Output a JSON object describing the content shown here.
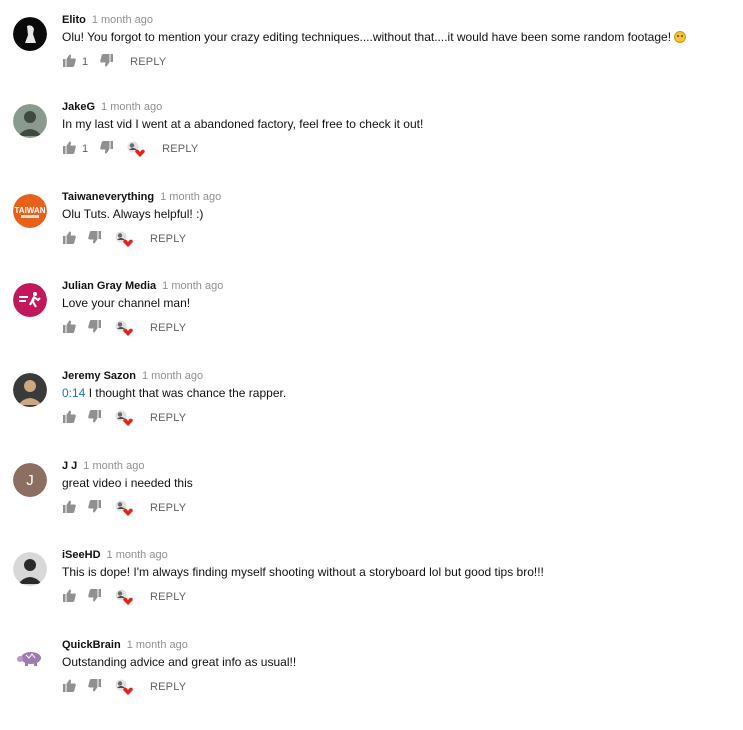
{
  "comments": [
    {
      "author": "Elito",
      "time": "1 month ago",
      "text": "Olu! You forgot to mention your crazy editing techniques....without that....it would have been some random footage!",
      "emoji": "grinning-face-emoji",
      "likes": "1",
      "reply_label": "REPLY",
      "creator_heart": false,
      "avatar": {
        "bg": "#0a0a0a",
        "fg": "#e8e8e8",
        "style": "silhouette"
      }
    },
    {
      "author": "JakeG",
      "time": "1 month ago",
      "text": "In my last vid I went at a abandoned factory, feel free to check it out!",
      "likes": "1",
      "reply_label": "REPLY",
      "creator_heart": true,
      "avatar": {
        "bg": "#8a9a8c",
        "fg": "#3e4a40",
        "style": "photo"
      }
    },
    {
      "author": "Taiwaneverything",
      "time": "1 month ago",
      "text": "Olu Tuts. Always helpful! :)",
      "likes": "",
      "reply_label": "REPLY",
      "creator_heart": true,
      "avatar": {
        "bg": "#e8611a",
        "fg": "#ffffff",
        "style": "logo-taiwan",
        "logo_text": "TAIWAN"
      }
    },
    {
      "author": "Julian Gray Media",
      "time": "1 month ago",
      "text": "Love your channel man!",
      "likes": "",
      "reply_label": "REPLY",
      "creator_heart": true,
      "avatar": {
        "bg": "#c2185b",
        "fg": "#ffffff",
        "style": "logo-runner"
      }
    },
    {
      "author": "Jeremy Sazon",
      "time": "1 month ago",
      "timestamp": "0:14",
      "text": " I thought that was chance the rapper.",
      "likes": "",
      "reply_label": "REPLY",
      "creator_heart": true,
      "avatar": {
        "bg": "#3a3a3a",
        "fg": "#c9a882",
        "style": "photo"
      }
    },
    {
      "author": "J J",
      "time": "1 month ago",
      "text": "great video i needed this",
      "likes": "",
      "reply_label": "REPLY",
      "creator_heart": true,
      "avatar": {
        "bg": "#8d6e63",
        "fg": "#ffffff",
        "style": "letter",
        "letter": "J"
      }
    },
    {
      "author": "iSeeHD",
      "time": "1 month ago",
      "text": "This is dope! I'm always finding myself shooting without a storyboard lol but good tips bro!!!",
      "likes": "",
      "reply_label": "REPLY",
      "creator_heart": true,
      "avatar": {
        "bg": "#d8d8d8",
        "fg": "#2a2a2a",
        "style": "photo"
      }
    },
    {
      "author": "QuickBrain",
      "time": "1 month ago",
      "text": "Outstanding advice and great info as usual!!",
      "likes": "",
      "reply_label": "REPLY",
      "creator_heart": true,
      "avatar": {
        "bg": "#ffffff",
        "fg": "#9c7bb0",
        "style": "turtle"
      }
    }
  ],
  "colors": {
    "icon": "#909090",
    "text_secondary": "#606060",
    "timestamp_link": "#1a6fc9",
    "heart": "#e62117"
  }
}
